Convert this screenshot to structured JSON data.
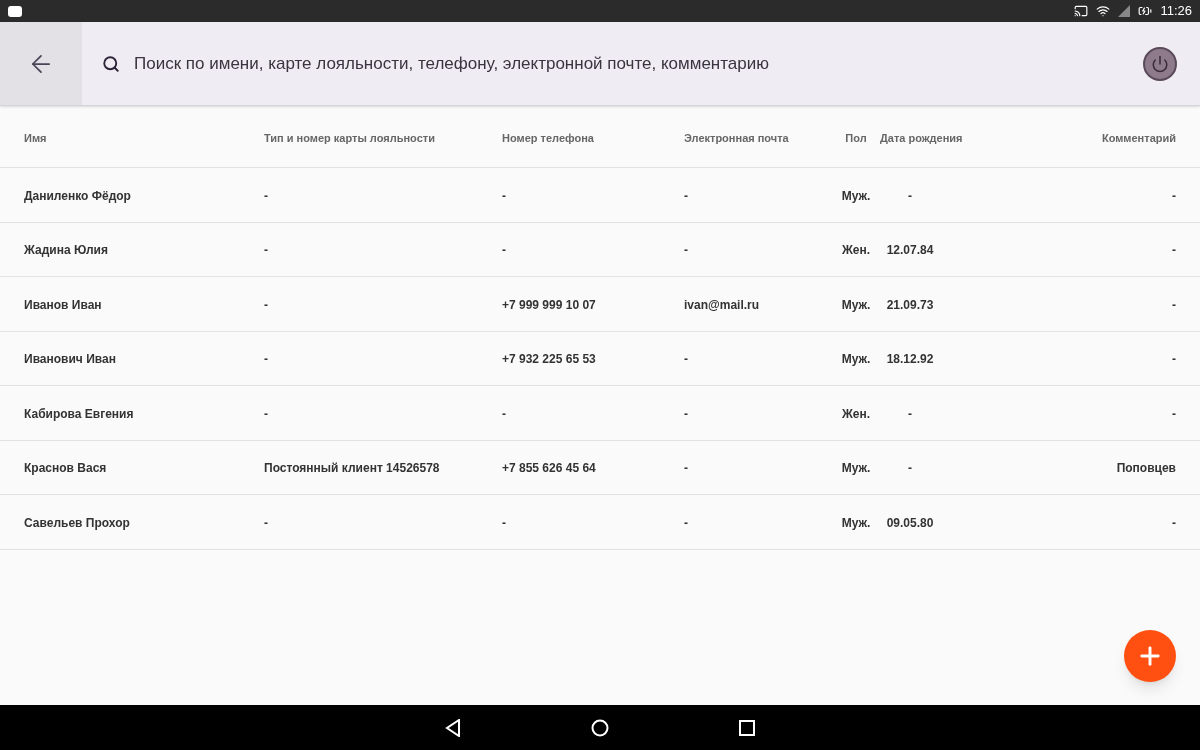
{
  "status_bar": {
    "time": "11:26"
  },
  "search": {
    "placeholder": "Поиск по имени, карте лояльности, телефону, электронной почте, комментарию"
  },
  "table": {
    "columns": [
      "Имя",
      "Тип и номер карты лояльности",
      "Номер телефона",
      "Электронная почта",
      "Пол",
      "Дата рождения",
      "Комментарий"
    ],
    "rows": [
      [
        "Даниленко Фёдор",
        "-",
        "-",
        "-",
        "Муж.",
        "-",
        "-"
      ],
      [
        "Жадина Юлия",
        "-",
        "-",
        "-",
        "Жен.",
        "12.07.84",
        "-"
      ],
      [
        "Иванов Иван",
        "-",
        "+7 999 999 10 07",
        "ivan@mail.ru",
        "Муж.",
        "21.09.73",
        "-"
      ],
      [
        "Иванович Иван",
        "-",
        "+7 932 225 65 53",
        "-",
        "Муж.",
        "18.12.92",
        "-"
      ],
      [
        "Кабирова Евгения",
        "-",
        "-",
        "-",
        "Жен.",
        "-",
        "-"
      ],
      [
        "Краснов Вася",
        "Постоянный клиент 14526578",
        "+7 855 626 45 64",
        "-",
        "Муж.",
        "-",
        "Поповцев"
      ],
      [
        "Савельев Прохор",
        "-",
        "-",
        "-",
        "Муж.",
        "09.05.80",
        "-"
      ]
    ]
  }
}
